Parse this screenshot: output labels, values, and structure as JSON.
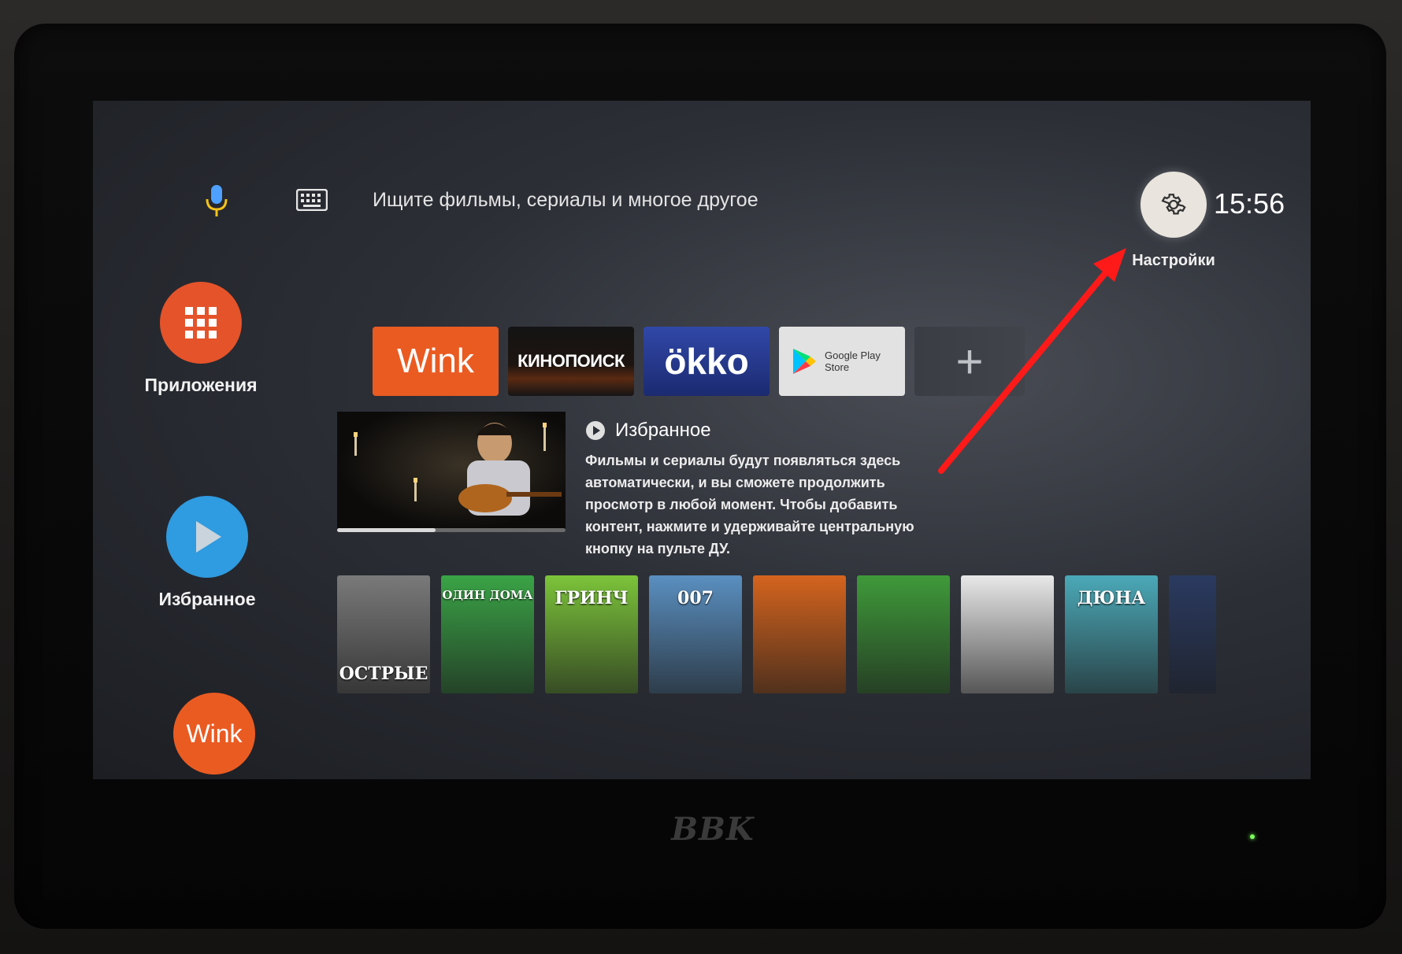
{
  "top_bar": {
    "search_placeholder": "Ищите фильмы, сериалы и многое другое",
    "settings_label": "Настройки",
    "clock": "15:56"
  },
  "left_rail": [
    {
      "label": "Приложения",
      "icon": "apps-grid-icon",
      "color": "#e5532a"
    },
    {
      "label": "Избранное",
      "icon": "play-icon",
      "color": "#2f9be0"
    },
    {
      "label": "Wink",
      "icon": "wink-logo",
      "color": "#ea5b22"
    }
  ],
  "apps_row": [
    {
      "name": "Wink",
      "label": "Wink"
    },
    {
      "name": "Кинопоиск",
      "label": "КИНОПОИСК"
    },
    {
      "name": "Okko",
      "label": "ökko"
    },
    {
      "name": "Google Play Store",
      "label_line1": "Google Play",
      "label_line2": "Store"
    },
    {
      "name": "add-app",
      "label": "+"
    }
  ],
  "favorites": {
    "title": "Избранное",
    "description": "Фильмы и сериалы будут появляться здесь автоматически, и вы сможете продолжить просмотр в любой момент. Чтобы добавить контент, нажмите и удерживайте центральную кнопку на пульте ДУ.",
    "progress": 0.43
  },
  "posters": [
    {
      "title": "ОСТРЫЕ",
      "color": "#7a7a7a"
    },
    {
      "title": "ОДИН ДОМА",
      "color": "#3aa346"
    },
    {
      "title": "ГРИНЧ",
      "color": "#7cc43a"
    },
    {
      "title": "007",
      "color": "#5a8fc0"
    },
    {
      "title": "",
      "color": "#d4641e"
    },
    {
      "title": "",
      "color": "#3f9a3a"
    },
    {
      "title": "",
      "color": "#e8e8e8"
    },
    {
      "title": "ДЮНА",
      "color": "#4ba9b8"
    },
    {
      "title": "",
      "color": "#2a3a60"
    }
  ],
  "tv": {
    "brand": "BBK"
  },
  "colors": {
    "annotation_arrow": "#ff1a1a",
    "screen_bg": "#2c2f36"
  }
}
